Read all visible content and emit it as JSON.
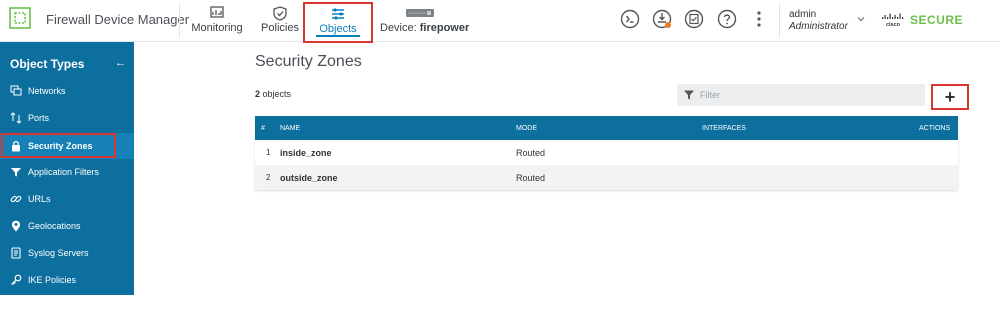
{
  "app": {
    "title": "Firewall Device Manager"
  },
  "nav": {
    "monitoring": "Monitoring",
    "policies": "Policies",
    "objects": "Objects",
    "device_prefix": "Device:",
    "device_name": "firepower"
  },
  "user": {
    "name": "admin",
    "role": "Administrator"
  },
  "brand": {
    "cisco": "cisco",
    "secure": "SECURE"
  },
  "sidebar": {
    "title": "Object Types",
    "items": [
      {
        "label": "Networks",
        "icon": "network-icon"
      },
      {
        "label": "Ports",
        "icon": "ports-icon"
      },
      {
        "label": "Security Zones",
        "icon": "lock-icon",
        "active": true
      },
      {
        "label": "Application Filters",
        "icon": "application-filter-icon"
      },
      {
        "label": "URLs",
        "icon": "link-icon"
      },
      {
        "label": "Geolocations",
        "icon": "map-pin-icon"
      },
      {
        "label": "Syslog Servers",
        "icon": "syslog-icon"
      },
      {
        "label": "IKE Policies",
        "icon": "key-icon"
      }
    ]
  },
  "main": {
    "title": "Security Zones",
    "count_number": "2",
    "count_suffix": "objects",
    "filter_placeholder": "Filter",
    "add_label": "+",
    "columns": [
      "#",
      "NAME",
      "MODE",
      "INTERFACES",
      "ACTIONS"
    ],
    "rows": [
      {
        "index": "1",
        "name": "inside_zone",
        "mode": "Routed",
        "interfaces": ""
      },
      {
        "index": "2",
        "name": "outside_zone",
        "mode": "Routed",
        "interfaces": ""
      }
    ]
  },
  "colors": {
    "accent": "#0a7fbd",
    "sidebar_bg": "#0d6f9e",
    "highlight": "#d8362f",
    "cisco_green": "#6cc04a"
  }
}
